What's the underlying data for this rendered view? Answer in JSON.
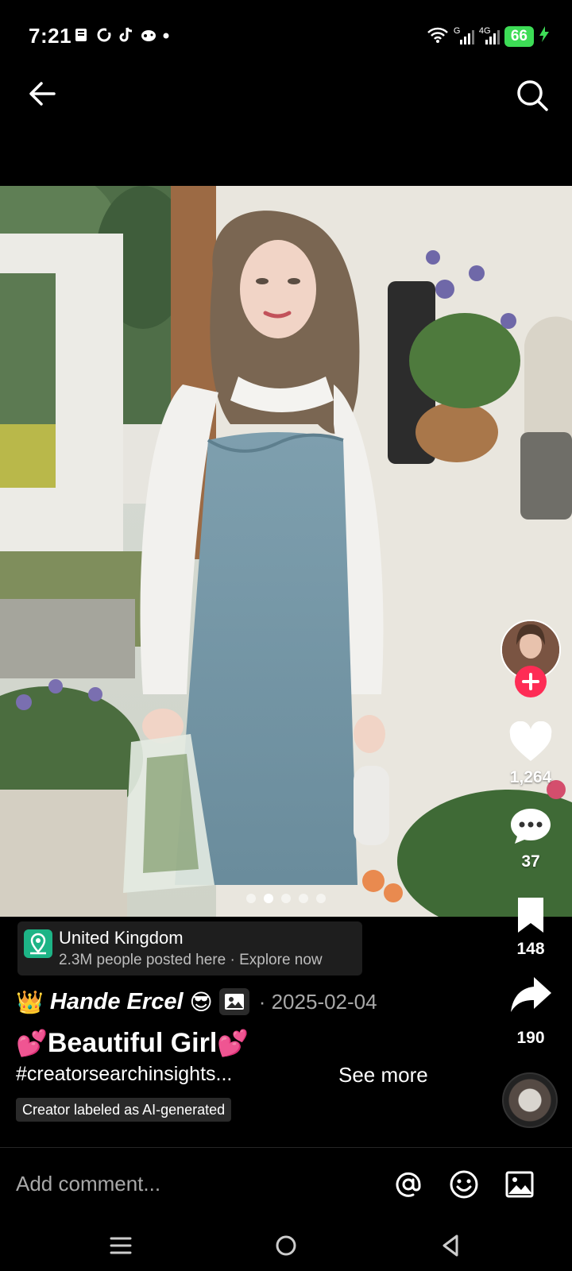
{
  "status_bar": {
    "time": "7:21",
    "left_icons": [
      "notes-icon",
      "sync-icon",
      "tiktok-icon",
      "game-icon",
      "dot-icon"
    ],
    "signal_labels": [
      "G",
      "4G"
    ],
    "battery": "66"
  },
  "top_nav": {
    "back_icon": "back-arrow-icon",
    "search_icon": "search-icon"
  },
  "carousel": {
    "dot_count": 5,
    "active_dot": 2
  },
  "actions": {
    "likes": "1,264",
    "comments": "37",
    "saves": "148",
    "shares": "190"
  },
  "location": {
    "name": "United Kingdom",
    "subtitle": "2.3M people posted here · Explore now"
  },
  "author": {
    "crown": "👑",
    "name": "Hande Ercel",
    "emoji": "😎",
    "date": "· 2025-02-04"
  },
  "caption": {
    "heart_left": "💕",
    "title": "Beautiful Girl",
    "heart_right": "💕",
    "hashtags": "#creatorsearchinsights...",
    "see_more": "See more"
  },
  "ai_label": "Creator labeled as AI-generated",
  "comment_bar": {
    "placeholder": "Add comment...",
    "icons": [
      "mention-icon",
      "emoji-icon",
      "image-icon"
    ]
  },
  "colors": {
    "follow": "#fe2c55",
    "battery": "#3ddc56",
    "location_icon": "#1db486"
  }
}
